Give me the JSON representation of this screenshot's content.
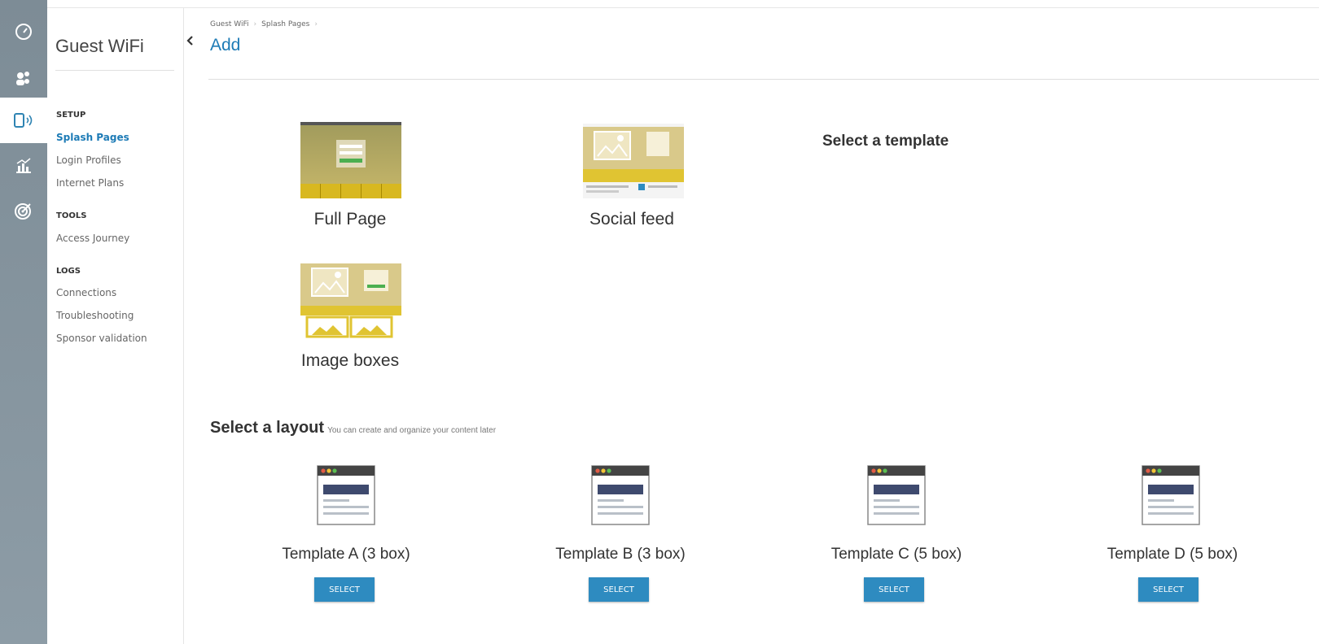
{
  "sidebar_rail": {
    "icons": [
      "dashboard-gauge-icon",
      "users-group-icon",
      "wifi-device-icon",
      "analytics-chart-icon",
      "target-icon"
    ],
    "active_index": 2
  },
  "subnav": {
    "title": "Guest WiFi",
    "sections": [
      {
        "heading": "SETUP",
        "items": [
          "Splash Pages",
          "Login Profiles",
          "Internet Plans"
        ]
      },
      {
        "heading": "TOOLS",
        "items": [
          "Access Journey"
        ]
      },
      {
        "heading": "LOGS",
        "items": [
          "Connections",
          "Troubleshooting",
          "Sponsor validation"
        ]
      }
    ],
    "active_item": "Splash Pages"
  },
  "breadcrumb": [
    "Guest WiFi",
    "Splash Pages"
  ],
  "page_title": "Add",
  "templates": {
    "heading": "Select a template",
    "items": [
      {
        "label": "Full Page"
      },
      {
        "label": "Social feed"
      },
      {
        "label": "Image boxes"
      }
    ]
  },
  "layouts": {
    "heading": "Select a layout",
    "subheading": "You can create and organize your content later",
    "items": [
      {
        "label": "Template A (3 box)",
        "button": "SELECT"
      },
      {
        "label": "Template B (3 box)",
        "button": "SELECT"
      },
      {
        "label": "Template C (5 box)",
        "button": "SELECT"
      },
      {
        "label": "Template D (5 box)",
        "button": "SELECT"
      }
    ]
  },
  "colors": {
    "accent": "#1d7bb6",
    "button": "#2e8bc0",
    "rail": "#8593a0"
  }
}
